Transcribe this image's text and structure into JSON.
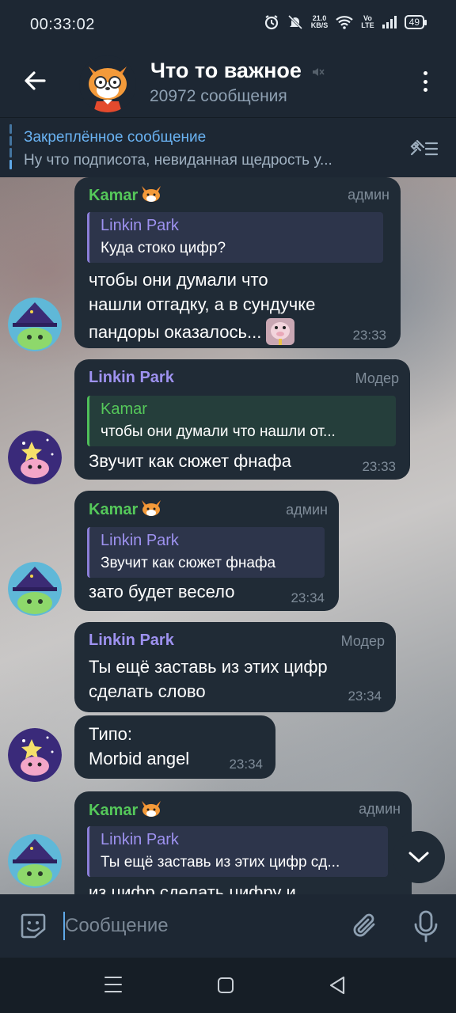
{
  "status_bar": {
    "time": "00:33:02",
    "net_speed_value": "21.0",
    "net_speed_unit": "KB/S",
    "carrier_top": "Vo",
    "carrier_bottom": "LTE",
    "battery": "49",
    "icons": [
      "alarm-icon",
      "mute-bell-icon",
      "wifi-icon",
      "signal-icon",
      "battery-icon"
    ]
  },
  "header": {
    "title": "Что то важное",
    "subtitle": "20972 сообщения",
    "icons": [
      "back-arrow-icon",
      "muted-speaker-icon",
      "more-vertical-icon"
    ]
  },
  "pinned": {
    "title": "Закреплённое сообщение",
    "text": "Ну что подписота, невиданная щедрость у..."
  },
  "messages": [
    {
      "sender": "Kamar",
      "role": "админ",
      "reply_name": "Linkin Park",
      "reply_text": "Куда стоко цифр?",
      "lines": [
        "чтобы они думали что",
        "нашли отгадку, а в сундучке",
        "пандоры оказалось..."
      ],
      "time": "23:33"
    },
    {
      "sender": "Linkin Park",
      "role": "Модер",
      "reply_name": "Kamar",
      "reply_text": "чтобы они думали что нашли от...",
      "lines": [
        "Звучит как сюжет фнафа"
      ],
      "time": "23:33"
    },
    {
      "sender": "Kamar",
      "role": "админ",
      "reply_name": "Linkin Park",
      "reply_text": "Звучит как сюжет фнафа",
      "lines": [
        "зато будет весело"
      ],
      "time": "23:34"
    },
    {
      "sender": "Linkin Park",
      "role": "Модер",
      "lines": [
        "Ты ещё заставь из этих цифр",
        "сделать слово"
      ],
      "time": "23:34"
    },
    {
      "lines": [
        "Типо:",
        "Morbid angel"
      ],
      "time": "23:34"
    },
    {
      "sender": "Kamar",
      "role": "админ",
      "reply_name": "Linkin Park",
      "reply_text": "Ты ещё заставь из этих цифр сд...",
      "lines": [
        "из цифр сделать цифру и"
      ]
    }
  ],
  "input": {
    "placeholder": "Сообщение"
  },
  "colors": {
    "accent": "#6ab3f3",
    "kamar_name": "#55c85a",
    "linkin_name": "#9e92f0",
    "bubble_bg": "#202b36",
    "header_bg": "#1d2733"
  }
}
